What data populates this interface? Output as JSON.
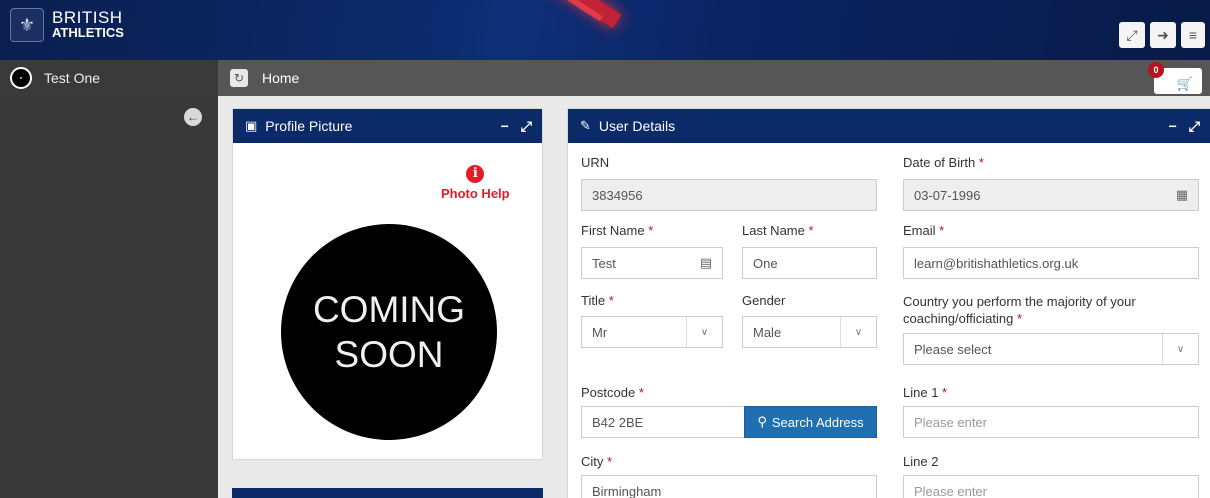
{
  "brand": {
    "line1": "BRITISH",
    "line2": "ATHLETICS"
  },
  "header_buttons": [
    {
      "name": "fullscreen-icon",
      "glyph": "⤢"
    },
    {
      "name": "logout-icon",
      "glyph": "⇥"
    },
    {
      "name": "menu-icon",
      "glyph": "≡"
    }
  ],
  "user": {
    "name": "Test One",
    "avatar_text": "COMING SOON"
  },
  "breadcrumb": {
    "home": "Home"
  },
  "cart": {
    "count": "0"
  },
  "profile_panel": {
    "title": "Profile Picture",
    "help": "Photo Help",
    "placeholder_line1": "COMING",
    "placeholder_line2": "SOON"
  },
  "user_panel": {
    "title": "User Details",
    "urn_label": "URN",
    "urn_value": "3834956",
    "dob_label": "Date of Birth",
    "dob_value": "03-07-1996",
    "first_name_label": "First Name",
    "first_name_value": "Test",
    "last_name_label": "Last Name",
    "last_name_value": "One",
    "email_label": "Email",
    "email_value": "learn@britishathletics.org.uk",
    "title_label": "Title",
    "title_value": "Mr",
    "gender_label": "Gender",
    "gender_value": "Male",
    "country_label_1": "Country you perform the majority of your",
    "country_label_2": "coaching/officiating",
    "country_value": "Please select",
    "postcode_label": "Postcode",
    "postcode_value": "B42 2BE",
    "search_button": "Search Address",
    "line1_label": "Line 1",
    "line1_placeholder": "Please enter",
    "city_label": "City",
    "city_value": "Birmingham",
    "line2_label": "Line 2",
    "line2_placeholder": "Please enter"
  },
  "required_mark": "*"
}
